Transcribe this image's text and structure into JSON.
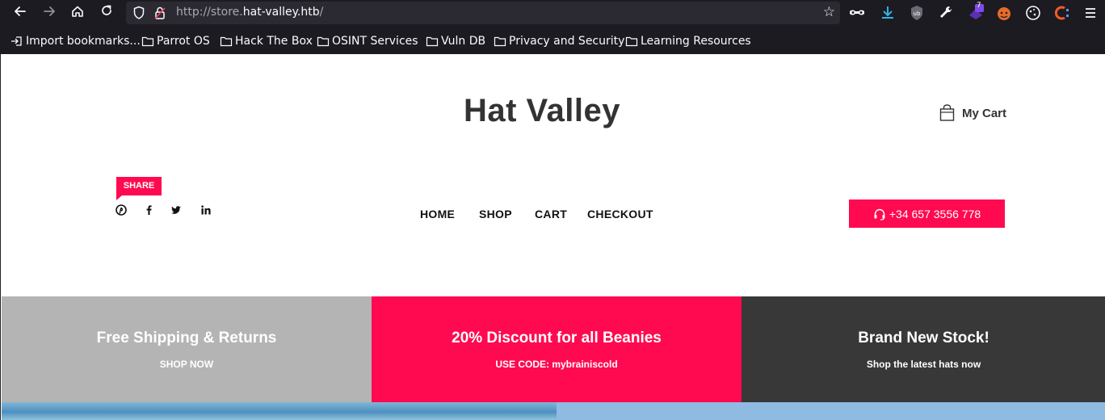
{
  "browser": {
    "url_prefix": "http://store.",
    "url_domain": "hat-valley.htb",
    "url_suffix": "/",
    "extension_badge": "7",
    "bookmarks": [
      "Import bookmarks...",
      "Parrot OS",
      "Hack The Box",
      "OSINT Services",
      "Vuln DB",
      "Privacy and Security",
      "Learning Resources"
    ]
  },
  "site": {
    "title": "Hat Valley",
    "cart_label": "My Cart",
    "share_label": "SHARE",
    "social": [
      "pinterest-icon",
      "facebook-icon",
      "twitter-icon",
      "linkedin-icon"
    ],
    "menu": [
      "HOME",
      "SHOP",
      "CART",
      "CHECKOUT"
    ],
    "phone": "+34 657 3556 778"
  },
  "promos": [
    {
      "title": "Free Shipping & Returns",
      "subtitle": "SHOP NOW"
    },
    {
      "title": "20% Discount for all Beanies",
      "subtitle": "USE CODE: mybrainiscold"
    },
    {
      "title": "Brand New Stock!",
      "subtitle": "Shop the latest hats now"
    }
  ],
  "colors": {
    "accent": "#ff0a50",
    "promo_grey": "#b4b4b4",
    "promo_dark": "#383838",
    "browser_bg": "#1c1b22"
  }
}
